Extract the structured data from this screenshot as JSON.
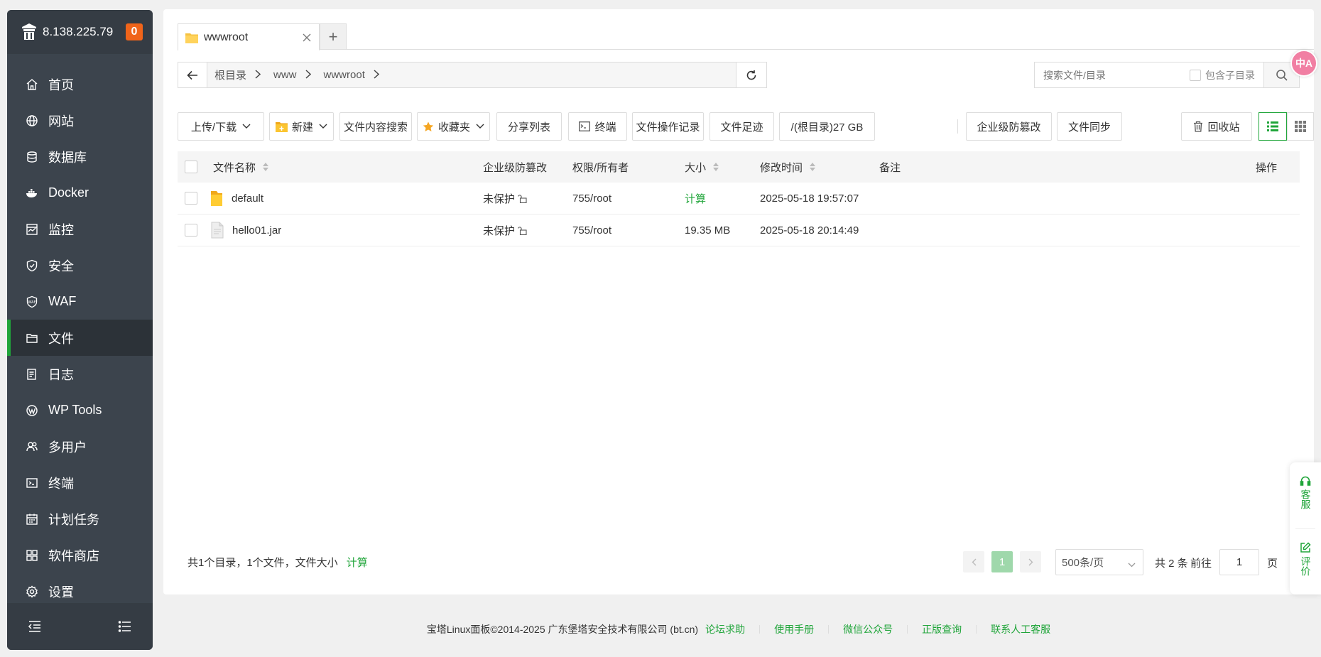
{
  "sidebar": {
    "ip": "8.138.225.79",
    "badge": "0",
    "items": [
      {
        "label": "首页",
        "icon": "home-icon"
      },
      {
        "label": "网站",
        "icon": "globe-icon"
      },
      {
        "label": "数据库",
        "icon": "database-icon"
      },
      {
        "label": "Docker",
        "icon": "docker-icon"
      },
      {
        "label": "监控",
        "icon": "monitor-icon"
      },
      {
        "label": "安全",
        "icon": "shield-icon"
      },
      {
        "label": "WAF",
        "icon": "waf-icon"
      },
      {
        "label": "文件",
        "icon": "folder-icon",
        "active": true
      },
      {
        "label": "日志",
        "icon": "log-icon"
      },
      {
        "label": "WP Tools",
        "icon": "wordpress-icon"
      },
      {
        "label": "多用户",
        "icon": "users-icon"
      },
      {
        "label": "终端",
        "icon": "terminal-icon"
      },
      {
        "label": "计划任务",
        "icon": "calendar-icon"
      },
      {
        "label": "软件商店",
        "icon": "apps-icon"
      },
      {
        "label": "设置",
        "icon": "gear-icon"
      }
    ]
  },
  "tabs": {
    "active_label": "wwwroot",
    "add_label": "+"
  },
  "path": {
    "crumbs": [
      "根目录",
      "www",
      "wwwroot"
    ]
  },
  "search": {
    "placeholder": "搜索文件/目录",
    "include_subdir": "包含子目录"
  },
  "toolbar": {
    "upload": "上传/下载",
    "new": "新建",
    "content_search": "文件内容搜索",
    "favorites": "收藏夹",
    "share_list": "分享列表",
    "terminal": "终端",
    "op_log": "文件操作记录",
    "footprint": "文件足迹",
    "disk": "/(根目录)27 GB",
    "tamper": "企业级防篡改",
    "sync": "文件同步",
    "recycle": "回收站"
  },
  "table": {
    "headers": {
      "name": "文件名称",
      "tamper": "企业级防篡改",
      "perm": "权限/所有者",
      "size": "大小",
      "mtime": "修改时间",
      "remark": "备注",
      "ops": "操作"
    },
    "rows": [
      {
        "name": "default",
        "type": "folder",
        "tamper": "未保护",
        "perm": "755/root",
        "size": "计算",
        "mtime": "2025-05-18 19:57:07"
      },
      {
        "name": "hello01.jar",
        "type": "file",
        "tamper": "未保护",
        "perm": "755/root",
        "size": "19.35 MB",
        "mtime": "2025-05-18 20:14:49"
      }
    ]
  },
  "summary": {
    "text": "共1个目录，1个文件，文件大小",
    "calc": "计算"
  },
  "pager": {
    "current": "1",
    "page_size": "500条/页",
    "total": "共 2 条",
    "goto": "前往",
    "goto_value": "1",
    "page_unit": "页"
  },
  "footer": {
    "copyright": "宝塔Linux面板©2014-2025 广东堡塔安全技术有限公司 (bt.cn)",
    "links": [
      "论坛求助",
      "使用手册",
      "微信公众号",
      "正版查询",
      "联系人工客服"
    ]
  },
  "float": {
    "service": "客服",
    "review": "评价"
  },
  "translate": {
    "label": "中A"
  },
  "colors": {
    "accent": "#20a53a",
    "sidebar_bg": "#3c444d",
    "badge": "#f0641a"
  }
}
